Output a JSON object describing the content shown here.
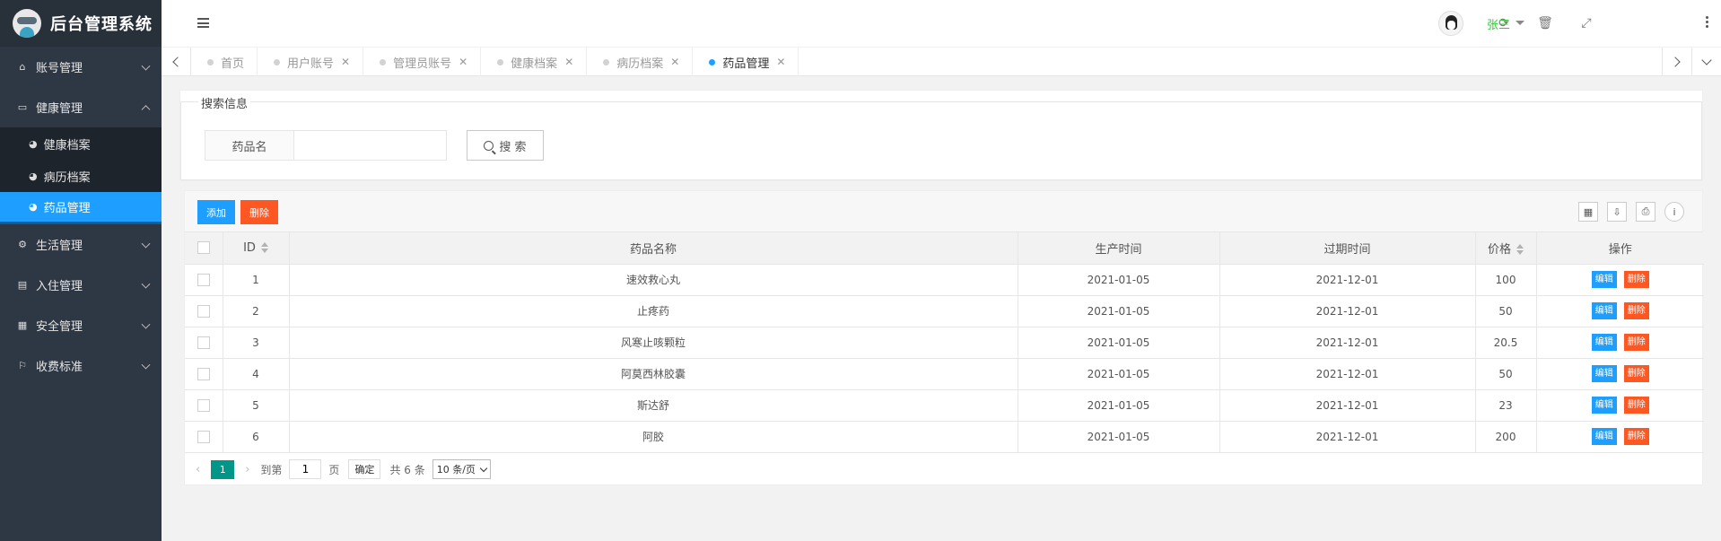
{
  "app": {
    "title": "后台管理系统"
  },
  "sidebar": {
    "items": [
      {
        "label": "账号管理",
        "icon": "home-icon",
        "expanded": false
      },
      {
        "label": "健康管理",
        "icon": "window-icon",
        "expanded": true,
        "children": [
          {
            "label": "健康档案",
            "icon": "dashboard-icon",
            "active": false
          },
          {
            "label": "病历档案",
            "icon": "dashboard-icon",
            "active": false
          },
          {
            "label": "药品管理",
            "icon": "dashboard-icon",
            "active": true
          }
        ]
      },
      {
        "label": "生活管理",
        "icon": "gears-icon",
        "expanded": false
      },
      {
        "label": "入住管理",
        "icon": "file-icon",
        "expanded": false
      },
      {
        "label": "安全管理",
        "icon": "calendar-icon",
        "expanded": false
      },
      {
        "label": "收费标准",
        "icon": "flag-icon",
        "expanded": false
      }
    ]
  },
  "header": {
    "username": "张三",
    "icons": [
      "menu-toggle-icon",
      "refresh-icon",
      "trash-icon",
      "fullscreen-icon",
      "avatar",
      "more-icon"
    ]
  },
  "tabs": [
    {
      "label": "首页",
      "closable": false,
      "active": false
    },
    {
      "label": "用户账号",
      "closable": true,
      "active": false
    },
    {
      "label": "管理员账号",
      "closable": true,
      "active": false
    },
    {
      "label": "健康档案",
      "closable": true,
      "active": false
    },
    {
      "label": "病历档案",
      "closable": true,
      "active": false
    },
    {
      "label": "药品管理",
      "closable": true,
      "active": true
    }
  ],
  "search": {
    "legend": "搜索信息",
    "field_label": "药品名",
    "value": "",
    "placeholder": "",
    "button_label": "搜 索"
  },
  "toolbar": {
    "add_label": "添加",
    "delete_label": "删除",
    "tool_icons": [
      "columns-icon",
      "export-icon",
      "print-icon",
      "info-icon"
    ]
  },
  "table": {
    "headers": {
      "id": "ID",
      "name": "药品名称",
      "produced": "生产时间",
      "expires": "过期时间",
      "price": "价格",
      "actions": "操作"
    },
    "edit_label": "编辑",
    "delete_label": "删除",
    "rows": [
      {
        "id": "1",
        "name": "速效救心丸",
        "produced": "2021-01-05",
        "expires": "2021-12-01",
        "price": "100"
      },
      {
        "id": "2",
        "name": "止疼药",
        "produced": "2021-01-05",
        "expires": "2021-12-01",
        "price": "50"
      },
      {
        "id": "3",
        "name": "风寒止咳颗粒",
        "produced": "2021-01-05",
        "expires": "2021-12-01",
        "price": "20.5"
      },
      {
        "id": "4",
        "name": "阿莫西林胶囊",
        "produced": "2021-01-05",
        "expires": "2021-12-01",
        "price": "50"
      },
      {
        "id": "5",
        "name": "斯达舒",
        "produced": "2021-01-05",
        "expires": "2021-12-01",
        "price": "23"
      },
      {
        "id": "6",
        "name": "阿胶",
        "produced": "2021-01-05",
        "expires": "2021-12-01",
        "price": "200"
      }
    ]
  },
  "pager": {
    "current_page": "1",
    "goto_label": "到第",
    "goto_value": "1",
    "page_suffix": "页",
    "confirm_label": "确定",
    "total_label": "共 6 条",
    "page_size": "10 条/页"
  },
  "colors": {
    "sidebar_bg": "#2e3744",
    "accent_blue": "#1e9fff",
    "danger": "#ff5722",
    "pager_active": "#009688",
    "username": "#35c73a"
  }
}
